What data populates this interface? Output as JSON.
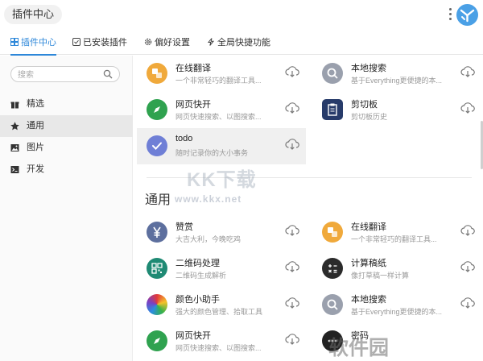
{
  "app": {
    "title": "插件中心"
  },
  "tabs": [
    {
      "label": "插件中心",
      "icon": "grid-icon"
    },
    {
      "label": "已安装插件",
      "icon": "checkbox-icon"
    },
    {
      "label": "偏好设置",
      "icon": "gear-icon"
    },
    {
      "label": "全局快捷功能",
      "icon": "lightning-icon"
    }
  ],
  "sidebar": {
    "search_placeholder": "搜索",
    "items": [
      {
        "label": "精选",
        "icon": "gift-icon"
      },
      {
        "label": "通用",
        "icon": "star-icon"
      },
      {
        "label": "图片",
        "icon": "image-icon"
      },
      {
        "label": "开发",
        "icon": "terminal-icon"
      }
    ]
  },
  "featured": [
    {
      "name": "在线翻译",
      "desc": "一个非常轻巧的翻译工具...",
      "icon": "translate-icon",
      "color": "#f0a93b"
    },
    {
      "name": "本地搜索",
      "desc": "基于Everything更便捷的本...",
      "icon": "magnifier-icon",
      "color": "#9aa0ad"
    },
    {
      "name": "网页快开",
      "desc": "网页快速搜索、以图搜索...",
      "icon": "compass-icon",
      "color": "#2fa24f"
    },
    {
      "name": "剪切板",
      "desc": "剪切板历史",
      "icon": "clipboard-icon",
      "color": "#273b6a"
    },
    {
      "name": "todo",
      "desc": "随时记录你的大小事务",
      "icon": "check-icon",
      "color": "#6f7fd6"
    }
  ],
  "section": {
    "title": "通用"
  },
  "general": [
    {
      "name": "赞赏",
      "desc": "大吉大利，今晚吃鸡",
      "icon": "yen-icon",
      "color": "#5d6f9e"
    },
    {
      "name": "在线翻译",
      "desc": "一个非常轻巧的翻译工具...",
      "icon": "translate-icon",
      "color": "#f0a93b"
    },
    {
      "name": "二维码处理",
      "desc": "二维码生成解析",
      "icon": "qrcode-icon",
      "color": "#1f8a74"
    },
    {
      "name": "计算稿纸",
      "desc": "像打草稿一样计算",
      "icon": "calculator-icon",
      "color": "#2b2b2b"
    },
    {
      "name": "颜色小助手",
      "desc": "强大的颜色管理、拾取工具",
      "icon": "color-wheel-icon",
      "color": "#e23a3a"
    },
    {
      "name": "本地搜索",
      "desc": "基于Everything更便捷的本...",
      "icon": "magnifier-icon",
      "color": "#9aa0ad"
    },
    {
      "name": "网页快开",
      "desc": "网页快速搜索、以图搜索...",
      "icon": "compass-icon",
      "color": "#2fa24f"
    },
    {
      "name": "密码",
      "desc": "",
      "icon": "chat-icon",
      "color": "#222222"
    }
  ],
  "watermarks": {
    "kkx": "KK下载",
    "kkx_url": "www.kkx.net",
    "soft": "软件园"
  }
}
